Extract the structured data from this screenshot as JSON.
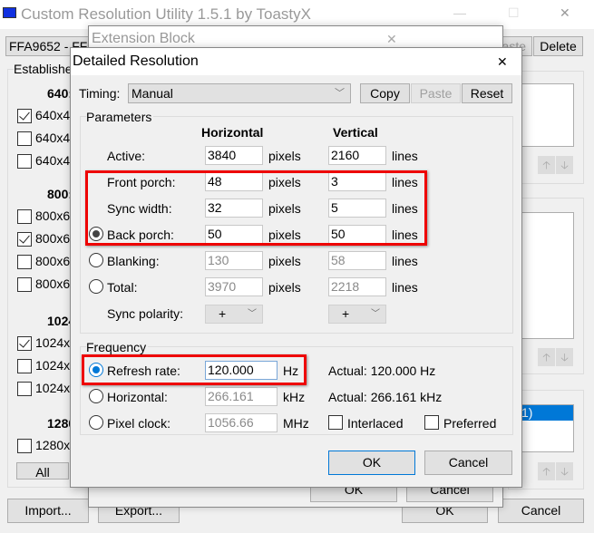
{
  "main": {
    "title": "Custom Resolution Utility 1.5.1 by ToastyX",
    "minimize": "—",
    "maximize": "☐",
    "close": "✕",
    "device": "FFA9652 - FFA",
    "paste_partial": "aste",
    "delete": "Delete",
    "established": "Establishe",
    "groups": [
      {
        "head": "640:",
        "items": [
          {
            "label": "640x4",
            "checked": true
          },
          {
            "label": "640x4",
            "checked": false
          },
          {
            "label": "640x4",
            "checked": false
          }
        ]
      },
      {
        "head": "800:",
        "items": [
          {
            "label": "800x6",
            "checked": false
          },
          {
            "label": "800x6",
            "checked": true
          },
          {
            "label": "800x6",
            "checked": false
          },
          {
            "label": "800x6",
            "checked": false
          }
        ]
      },
      {
        "head": "1024",
        "items": [
          {
            "label": "1024x",
            "checked": true
          },
          {
            "label": "1024x",
            "checked": false
          },
          {
            "label": "1024x",
            "checked": false
          }
        ]
      },
      {
        "head": "1280",
        "items": [
          {
            "label": "1280x",
            "checked": false
          }
        ]
      }
    ],
    "all": "All",
    "import": "Import...",
    "export": "Export...",
    "ok": "OK",
    "cancel": "Cancel",
    "selected_item_partial": "1)",
    "up": "🡡",
    "down": "🡣"
  },
  "extension": {
    "title": "Extension Block",
    "close": "✕",
    "ok": "OK",
    "cancel": "Cancel"
  },
  "dialog": {
    "title": "Detailed Resolution",
    "close": "✕",
    "timing_label": "Timing:",
    "timing_value": "Manual",
    "copy": "Copy",
    "paste": "Paste",
    "reset": "Reset",
    "parameters": "Parameters",
    "horizontal": "Horizontal",
    "vertical": "Vertical",
    "pixels": "pixels",
    "lines": "lines",
    "rows": [
      {
        "label": "Active:",
        "h": "3840",
        "v": "2160"
      },
      {
        "label": "Front porch:",
        "h": "48",
        "v": "3"
      },
      {
        "label": "Sync width:",
        "h": "32",
        "v": "5"
      },
      {
        "label": "Back porch:",
        "h": "50",
        "v": "50"
      },
      {
        "label": "Blanking:",
        "h": "130",
        "v": "58"
      },
      {
        "label": "Total:",
        "h": "3970",
        "v": "2218"
      }
    ],
    "sync_polarity": "Sync polarity:",
    "h_polarity": "+",
    "v_polarity": "+",
    "frequency": "Frequency",
    "refresh_label": "Refresh rate:",
    "refresh_value": "120.000",
    "hz": "Hz",
    "actual_refresh": "Actual: 120.000 Hz",
    "horizontal_label": "Horizontal:",
    "horizontal_value": "266.161",
    "khz": "kHz",
    "actual_horizontal": "Actual: 266.161 kHz",
    "pixel_clock_label": "Pixel clock:",
    "pixel_clock_value": "1056.66",
    "mhz": "MHz",
    "interlaced": "Interlaced",
    "preferred": "Preferred",
    "ok": "OK",
    "cancel": "Cancel"
  },
  "colors": {
    "highlight": "#e00000",
    "accent": "#0078d7"
  }
}
